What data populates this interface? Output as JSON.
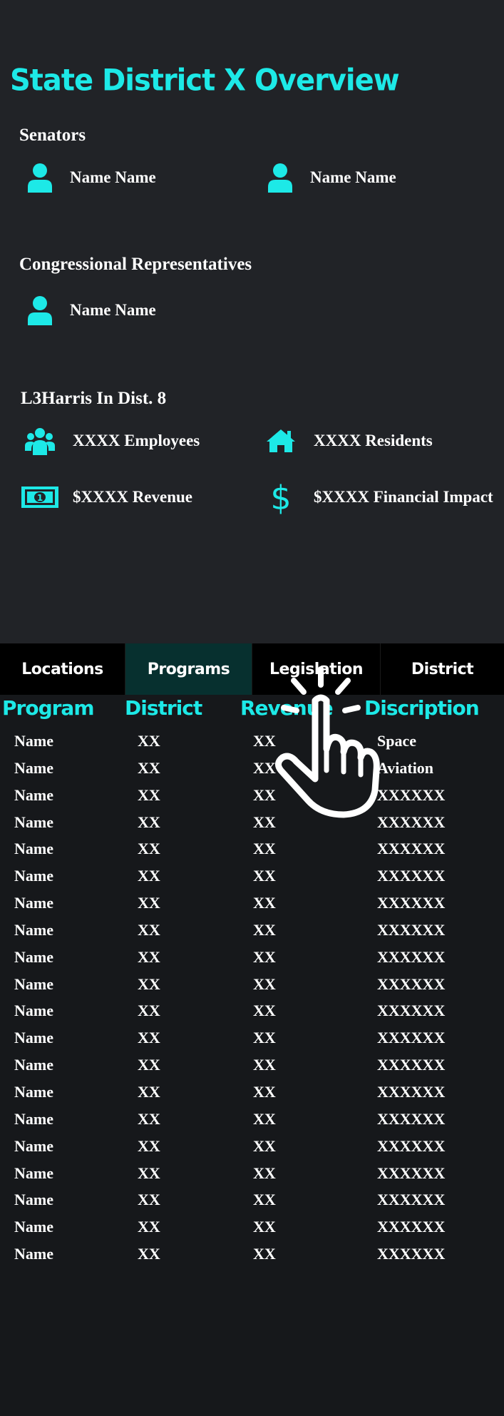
{
  "header": {
    "title": "State District X Overview"
  },
  "senators": {
    "heading": "Senators",
    "people": [
      {
        "name": "Name Name",
        "icon": "person-icon"
      },
      {
        "name": "Name Name",
        "icon": "person-icon"
      }
    ]
  },
  "congress": {
    "heading": "Congressional Representatives",
    "people": [
      {
        "name": "Name Name",
        "icon": "person-icon"
      }
    ]
  },
  "l3harris": {
    "heading": "L3Harris In Dist. 8",
    "stats": [
      {
        "label": "XXXX Employees",
        "icon": "group-icon"
      },
      {
        "label": "XXXX Residents",
        "icon": "house-icon"
      },
      {
        "label": "$XXXX Revenue",
        "icon": "banknote-icon"
      },
      {
        "label": "$XXXX Financial Impact",
        "icon": "dollar-icon"
      }
    ]
  },
  "tabs": [
    {
      "label": "Locations",
      "active": false
    },
    {
      "label": "Programs",
      "active": true
    },
    {
      "label": "Legislation",
      "active": false
    },
    {
      "label": "District",
      "active": false
    }
  ],
  "table": {
    "headers": [
      "Program",
      "District",
      "Revenue",
      "Discription"
    ],
    "rows": [
      [
        "Name",
        "XX",
        "XX",
        "Space"
      ],
      [
        "Name",
        "XX",
        "XX",
        "Aviation"
      ],
      [
        "Name",
        "XX",
        "XX",
        "XXXXXX"
      ],
      [
        "Name",
        "XX",
        "XX",
        "XXXXXX"
      ],
      [
        "Name",
        "XX",
        "XX",
        "XXXXXX"
      ],
      [
        "Name",
        "XX",
        "XX",
        "XXXXXX"
      ],
      [
        "Name",
        "XX",
        "XX",
        "XXXXXX"
      ],
      [
        "Name",
        "XX",
        "XX",
        "XXXXXX"
      ],
      [
        "Name",
        "XX",
        "XX",
        "XXXXXX"
      ],
      [
        "Name",
        "XX",
        "XX",
        "XXXXXX"
      ],
      [
        "Name",
        "XX",
        "XX",
        "XXXXXX"
      ],
      [
        "Name",
        "XX",
        "XX",
        "XXXXXX"
      ],
      [
        "Name",
        "XX",
        "XX",
        "XXXXXX"
      ],
      [
        "Name",
        "XX",
        "XX",
        "XXXXXX"
      ],
      [
        "Name",
        "XX",
        "XX",
        "XXXXXX"
      ],
      [
        "Name",
        "XX",
        "XX",
        "XXXXXX"
      ],
      [
        "Name",
        "XX",
        "XX",
        "XXXXXX"
      ],
      [
        "Name",
        "XX",
        "XX",
        "XXXXXX"
      ],
      [
        "Name",
        "XX",
        "XX",
        "XXXXXX"
      ],
      [
        "Name",
        "XX",
        "XX",
        "XXXXXX"
      ]
    ]
  },
  "overlay": {
    "icon": "tap-hand-icon"
  },
  "colors": {
    "accent": "#1de9e7",
    "top_background": "#212327",
    "page_background": "#16181b",
    "tab_bar": "#000000",
    "tab_active": "#07302f",
    "text": "#ffffff"
  }
}
